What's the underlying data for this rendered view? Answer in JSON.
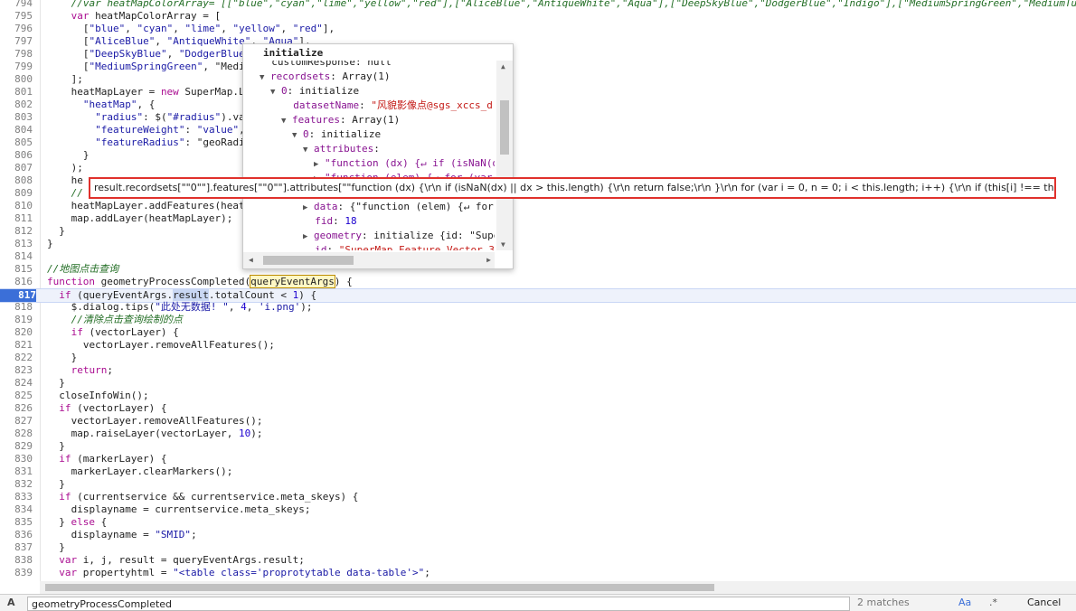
{
  "code_lines": [
    {
      "n": "794",
      "html": "<span class=\"cm\">//var heatMapColorArray= [[\"blue\",\"cyan\",\"lime\",\"yellow\",\"red\"],[\"AliceBlue\",\"AntiqueWhite\",\"Aqua\"],[\"DeepSkyBlue\",\"DodgerBlue\",\"Indigo\"],[\"MediumSpringGreen\",\"MediumTu</span>",
      "indent": 2
    },
    {
      "n": "795",
      "text": "var heatMapColorArray = [",
      "indent": 2
    },
    {
      "n": "796",
      "text": "[\"blue\", \"cyan\", \"lime\", \"yellow\", \"red\"],",
      "indent": 3
    },
    {
      "n": "797",
      "text": "[\"AliceBlue\", \"AntiqueWhite\", \"Aqua\"],",
      "indent": 3
    },
    {
      "n": "798",
      "text": "[\"DeepSkyBlue\", \"DodgerBlue\",",
      "indent": 3
    },
    {
      "n": "799",
      "text": "[\"MediumSpringGreen\", \"Medi",
      "indent": 3
    },
    {
      "n": "800",
      "text": "];",
      "indent": 2
    },
    {
      "n": "801",
      "text": "heatMapLayer = new SuperMap.L",
      "indent": 2
    },
    {
      "n": "802",
      "text": "\"heatMap\", {",
      "indent": 3
    },
    {
      "n": "803",
      "text": "\"radius\": $(\"#radius\").va",
      "indent": 4
    },
    {
      "n": "804",
      "text": "\"featureWeight\": \"value\",",
      "indent": 4
    },
    {
      "n": "805",
      "text": "\"featureRadius\": \"geoRadi",
      "indent": 4
    },
    {
      "n": "806",
      "text": "}",
      "indent": 3
    },
    {
      "n": "807",
      "text": ");",
      "indent": 2
    },
    {
      "n": "808",
      "text": "he",
      "indent": 2
    },
    {
      "n": "809",
      "text": "//",
      "indent": 2
    },
    {
      "n": "810",
      "text": "heatMapLayer.addFeatures(heat",
      "indent": 2
    },
    {
      "n": "811",
      "text": "map.addLayer(heatMapLayer);",
      "indent": 2
    },
    {
      "n": "812",
      "text": "}",
      "indent": 1
    },
    {
      "n": "813",
      "text": "}",
      "indent": 0
    },
    {
      "n": "814",
      "text": "",
      "indent": 0
    },
    {
      "n": "815",
      "text": "//地图点击查询",
      "indent": 0
    },
    {
      "n": "816",
      "text": "function geometryProcessCompleted(queryEventArgs) {",
      "indent": 0
    },
    {
      "n": "817",
      "text": "if (queryEventArgs.result.totalCount < 1) {",
      "indent": 1
    },
    {
      "n": "818",
      "text": "$.dialog.tips(\"此处无数据! \", 4, 'i.png');",
      "indent": 2
    },
    {
      "n": "819",
      "text": "//清除点击查询绘制的点",
      "indent": 2
    },
    {
      "n": "820",
      "text": "if (vectorLayer) {",
      "indent": 2
    },
    {
      "n": "821",
      "text": "vectorLayer.removeAllFeatures();",
      "indent": 3
    },
    {
      "n": "822",
      "text": "}",
      "indent": 2
    },
    {
      "n": "823",
      "text": "return;",
      "indent": 2
    },
    {
      "n": "824",
      "text": "}",
      "indent": 1
    },
    {
      "n": "825",
      "text": "closeInfoWin();",
      "indent": 1
    },
    {
      "n": "826",
      "text": "if (vectorLayer) {",
      "indent": 1
    },
    {
      "n": "827",
      "text": "vectorLayer.removeAllFeatures();",
      "indent": 2
    },
    {
      "n": "828",
      "text": "map.raiseLayer(vectorLayer, 10);",
      "indent": 2
    },
    {
      "n": "829",
      "text": "}",
      "indent": 1
    },
    {
      "n": "830",
      "text": "if (markerLayer) {",
      "indent": 1
    },
    {
      "n": "831",
      "text": "markerLayer.clearMarkers();",
      "indent": 2
    },
    {
      "n": "832",
      "text": "}",
      "indent": 1
    },
    {
      "n": "833",
      "text": "if (currentservice && currentservice.meta_skeys) {",
      "indent": 1
    },
    {
      "n": "834",
      "text": "displayname = currentservice.meta_skeys;",
      "indent": 2
    },
    {
      "n": "835",
      "text": "} else {",
      "indent": 1
    },
    {
      "n": "836",
      "text": "displayname = \"SMID\";",
      "indent": 2
    },
    {
      "n": "837",
      "text": "}",
      "indent": 1
    },
    {
      "n": "838",
      "text": "var i, j, result = queryEventArgs.result;",
      "indent": 1
    },
    {
      "n": "839",
      "text": "var propertyhtml = \"<table class='proprotytable data-table'>\";",
      "indent": 1
    }
  ],
  "current_line": "817",
  "popover": {
    "title": "initialize",
    "rows": [
      {
        "indent": 0,
        "tri": "",
        "text": "customResponse: null"
      },
      {
        "indent": 0,
        "tri": "▼",
        "key": "recordsets",
        "val": "Array(1)"
      },
      {
        "indent": 1,
        "tri": "▼",
        "key": "0",
        "val": "initialize"
      },
      {
        "indent": 2,
        "tri": "",
        "key": "datasetName",
        "sval": "\"风貌影像点@sgs_xccs_d"
      },
      {
        "indent": 2,
        "tri": "▼",
        "key": "features",
        "val": "Array(1)"
      },
      {
        "indent": 3,
        "tri": "▼",
        "key": "0",
        "val": "initialize"
      },
      {
        "indent": 4,
        "tri": "▼",
        "key": "attributes",
        "val": ""
      },
      {
        "indent": 5,
        "tri": "▶",
        "key": "\"function (dx) {↵ if (isNaN(d",
        "val": ""
      },
      {
        "indent": 5,
        "tri": "▶",
        "key": "\"function (elem) {↵ for (var",
        "val": ""
      },
      {
        "indent": 4,
        "tri": "",
        "key": "",
        "val": ""
      },
      {
        "indent": 4,
        "tri": "▶",
        "key": "data",
        "val": "{\"function (elem) {↵ for"
      },
      {
        "indent": 4,
        "tri": "",
        "key": "fid",
        "nval": "18"
      },
      {
        "indent": 4,
        "tri": "▶",
        "key": "geometry",
        "val": "initialize {id: \"Supe"
      },
      {
        "indent": 4,
        "tri": "",
        "key": "id",
        "sval": "\"SuperMap.Feature.Vector_3"
      }
    ]
  },
  "tooltip": {
    "text": "result.recordsets[\"\"0\"\"].features[\"\"0\"\"].attributes[\"\"function (dx) {\\r\\n if (isNaN(dx) || dx > this.length) {\\r\\n return false;\\r\\n }\\r\\n for (var i = 0, n = 0; i < this.length; i++) {\\r\\n if (this[i] !== this[dx]) {\\r\\n this[n++"
  },
  "searchbar": {
    "icon": "A",
    "query": "geometryProcessCompleted",
    "count": "2 matches",
    "aa_label": "Aa",
    "regex_label": ".*",
    "cancel_label": "Cancel"
  }
}
